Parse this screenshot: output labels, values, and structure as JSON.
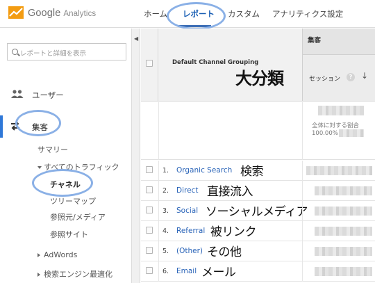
{
  "app": {
    "brand_google": "Google",
    "brand_product": "Analytics"
  },
  "nav": {
    "home": "ホーム",
    "reports": "レポート",
    "custom": "カスタム",
    "admin": "アナリティクス設定"
  },
  "sidebar": {
    "search_placeholder": "レポートと詳細を表示",
    "users": "ユーザー",
    "acquisition": "集客",
    "summary": "サマリー",
    "all_traffic": "すべてのトラフィック",
    "channels": "チャネル",
    "treemap": "ツリーマップ",
    "source_medium": "参照元/メディア",
    "referrals": "参照サイト",
    "adwords": "AdWords",
    "seo": "検索エンジン最適化"
  },
  "table": {
    "group_header": "集客",
    "dimension_header": "Default Channel Grouping",
    "metric_header": "セッション",
    "totals_label": "全体に対する割合",
    "totals_percent": "100.00%",
    "rows": [
      {
        "index": "1.",
        "channel": "Organic Search",
        "note": "検索"
      },
      {
        "index": "2.",
        "channel": "Direct",
        "note": "直接流入"
      },
      {
        "index": "3.",
        "channel": "Social",
        "note": "ソーシャルメディア"
      },
      {
        "index": "4.",
        "channel": "Referral",
        "note": "被リンク"
      },
      {
        "index": "5.",
        "channel": "(Other)",
        "note": "その他"
      },
      {
        "index": "6.",
        "channel": "Email",
        "note": "メール"
      }
    ]
  },
  "annotations": {
    "dimension_note": "大分類"
  },
  "colors": {
    "accent": "#2f78d8",
    "link": "#2a64b8",
    "highlight_oval": "#8ab0e6",
    "logo_orange": "#f5a623"
  }
}
